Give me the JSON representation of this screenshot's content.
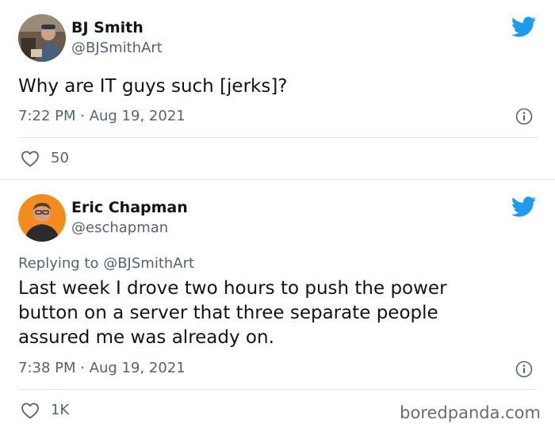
{
  "tweets": [
    {
      "name": "BJ Smith",
      "handle": "@BJSmithArt",
      "text": "Why are IT guys such [jerks]?",
      "timestamp": "7:22 PM · Aug 19, 2021",
      "likes": "50",
      "icons": [
        "twitter-bird-icon",
        "info-icon",
        "heart-icon"
      ]
    },
    {
      "name": "Eric Chapman",
      "handle": "@eschapman",
      "replying_to": "Replying to @BJSmithArt",
      "text_lines": [
        "Last week I drove two hours to push the power",
        "button on a server that three separate people",
        "assured me was already on."
      ],
      "timestamp": "7:38 PM · Aug 19, 2021",
      "likes": "1K",
      "icons": [
        "twitter-bird-icon",
        "info-icon",
        "heart-icon"
      ]
    }
  ],
  "watermark": "boredpanda.com",
  "colors": {
    "twitter_blue": "#1d9bf0",
    "text_primary": "#0f1419",
    "text_secondary": "#536471",
    "divider": "#e1e8ed"
  }
}
